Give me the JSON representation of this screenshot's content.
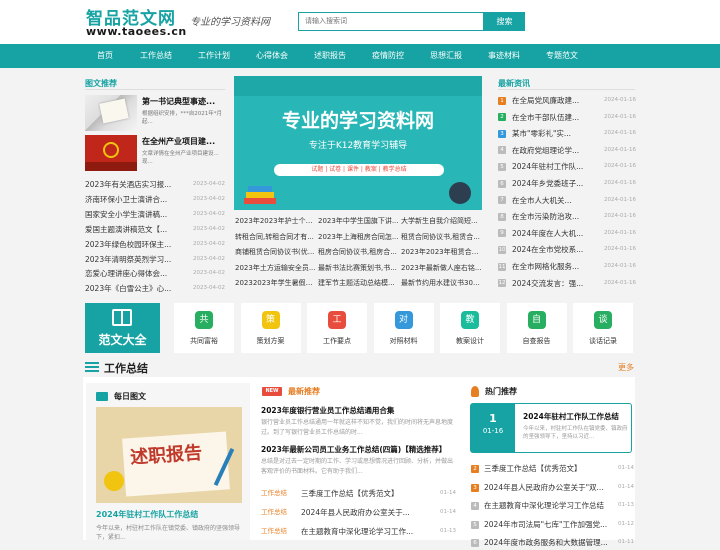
{
  "header": {
    "logo_cn": "智品范文网",
    "logo_en": "www.taoees.cn",
    "slogan": "专业的学习资料网",
    "search_placeholder": "请输入搜索词",
    "search_button": "搜索"
  },
  "nav": [
    "首页",
    "工作总结",
    "工作计划",
    "心得体会",
    "述职报告",
    "疫情防控",
    "思想汇报",
    "事迹材料",
    "专题范文"
  ],
  "pic_rec": {
    "title": "图文推荐",
    "items": [
      {
        "title": "第一书记典型事迹...",
        "desc": "根据组织安排，***自2021年*月起..."
      },
      {
        "title": "在全州产业项目建...",
        "desc": "文章详情在全州产业项目建设...现..."
      }
    ],
    "list": [
      {
        "t": "2023年有关酒店实习报...",
        "d": "2023-04-02"
      },
      {
        "t": "济南环保小卫士演讲合...",
        "d": "2023-04-02"
      },
      {
        "t": "国家安全小学生演讲稿...",
        "d": "2023-04-02"
      },
      {
        "t": "爱国主题演讲稿范文【...",
        "d": "2023-04-02"
      },
      {
        "t": "2023年绿色校园环保主...",
        "d": "2023-04-02"
      },
      {
        "t": "2023年清明祭英烈学习...",
        "d": "2023-04-02"
      },
      {
        "t": "恋爱心理讲座心得体会...",
        "d": "2023-04-02"
      },
      {
        "t": "2023年《白雪公主》心...",
        "d": "2023-04-02"
      }
    ]
  },
  "banner": {
    "title": "专业的学习资料网",
    "sub": "专注于K12教育学习辅导",
    "menu": "试题 | 试卷 | 课件 | 教案 | 教学总结"
  },
  "mid_links": [
    "2023年2023年护士个人...",
    "2023年中学生国旗下讲...",
    "大学新生自我介绍简短...",
    "转租合同,转租合同才有...",
    "2023年上海租房合同怎...",
    "租赁合同协议书,租赁合...",
    "商铺租赁合同协议书(优...",
    "租房合同协议书,租房合...",
    "2023年2023年租赁合同...",
    "2023年土方运输安全员...",
    "最新书法比赛策划书,书...",
    "2023年最新做人座右铭...",
    "20232023年学生暑假调...",
    "建军节主题活动总结模...",
    "最新节约用水建议书300..."
  ],
  "latest": {
    "title": "最新资讯",
    "items": [
      {
        "t": "在全局党风廉政建...",
        "d": "2024-01-16"
      },
      {
        "t": "在全市干部队伍建...",
        "d": "2024-01-16"
      },
      {
        "t": "某市\"零彩礼\"实...",
        "d": "2024-01-16"
      },
      {
        "t": "在政府党组理论学...",
        "d": "2024-01-16"
      },
      {
        "t": "2024年驻村工作队...",
        "d": "2024-01-16"
      },
      {
        "t": "2024年乡党委班子...",
        "d": "2024-01-16"
      },
      {
        "t": "在全市人大机关...",
        "d": "2024-01-16"
      },
      {
        "t": "在全市污染防治攻...",
        "d": "2024-01-16"
      },
      {
        "t": "2024年度在人大机...",
        "d": "2024-01-16"
      },
      {
        "t": "2024在全市党校系...",
        "d": "2024-01-16"
      },
      {
        "t": "在全市网格化服务...",
        "d": "2024-01-16"
      },
      {
        "t": "2024交流发言：强...",
        "d": "2024-01-16"
      }
    ]
  },
  "cats": {
    "main": "范文大全",
    "items": [
      {
        "icon": "共",
        "label": "共同富裕",
        "color": "#27ae60"
      },
      {
        "icon": "策",
        "label": "策划方案",
        "color": "#f1c40f"
      },
      {
        "icon": "工",
        "label": "工作要点",
        "color": "#e74c3c"
      },
      {
        "icon": "对",
        "label": "对照材料",
        "color": "#3498db"
      },
      {
        "icon": "教",
        "label": "教案设计",
        "color": "#1abc9c"
      },
      {
        "icon": "自",
        "label": "自查报告",
        "color": "#27ae60"
      },
      {
        "icon": "谈",
        "label": "谈话记录",
        "color": "#27ae60"
      }
    ]
  },
  "section": {
    "title": "工作总结",
    "more": "更多"
  },
  "daily": {
    "title": "每日图文",
    "img_text": "述职报告",
    "article": "2024年驻村工作队工作总结",
    "desc": "今年以来，村驻村工作队在镇党委、镇政府的坚强领导下，紧扣...",
    "new": "NEW",
    "rec_title": "最新推荐"
  },
  "mid_articles": [
    {
      "t": "2023年度银行营业员工作总结通用合集",
      "desc": "银行营业员工作总结通用一年就这样不知不觉，我们的时间将无声息地度过。到了写银行营业员工作总结的时..."
    },
    {
      "t": "2023年最新公司员工业务工作总结(四篇)【精选推荐】",
      "desc": "总结是对过去一定时期的工作、学习或思想情况进行回顾、分析，并做出客观评价的书面材料。它有助于我们..."
    }
  ],
  "tag_rows": [
    {
      "tag": "工作总结",
      "t": "三季度工作总结【优秀范文】",
      "d": "01-14"
    },
    {
      "tag": "工作总结",
      "t": "2024年县人民政府办公室关于...",
      "d": "01-14"
    },
    {
      "tag": "工作总结",
      "t": "在主题教育中深化理论学习工作...",
      "d": "01-13"
    }
  ],
  "hot": {
    "title": "热门推荐",
    "top": {
      "day": "1",
      "date": "01-16",
      "t": "2024年驻村工作队工作总结",
      "desc": "今年以来，村驻村工作队在镇党委、镇政府的坚强领导下，坚持以习近..."
    },
    "items": [
      {
        "t": "三季度工作总结【优秀范文】",
        "d": "01-14"
      },
      {
        "t": "2024年县人民政府办公室关于\"双...",
        "d": "01-14"
      },
      {
        "t": "在主题教育中深化理论学习工作总结",
        "d": "01-13"
      },
      {
        "t": "2024年市司法局\"七库\"工作加强党...",
        "d": "01-12"
      },
      {
        "t": "2024年度市政务服务和大数据管理...",
        "d": "01-11"
      }
    ]
  }
}
